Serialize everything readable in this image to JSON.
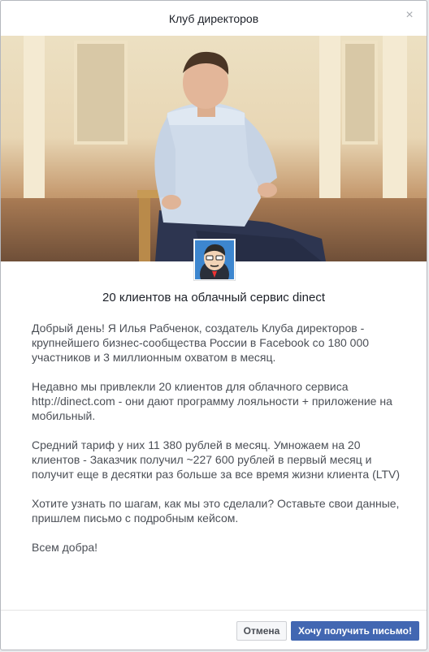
{
  "dialog": {
    "title": "Клуб директоров",
    "close_label": "×"
  },
  "content": {
    "headline": "20 клиентов на облачный сервис dinect",
    "paragraphs": [
      "Добрый день! Я Илья Рабченок, создатель Клуба директоров - крупнейшего бизнес-сообщества России в Facebook со 180 000 участников и 3 миллионным охватом в месяц.",
      "Недавно мы привлекли 20 клиентов для облачного сервиса http://dinect.com - они дают программу лояльности + приложение на мобильный.",
      "Средний тариф у них 11 380 рублей в месяц. Умножаем на 20 клиентов - Заказчик получил ~227 600 рублей в первый месяц и получит еще в десятки раз больше за все время жизни клиента (LTV)",
      "Хотите узнать по шагам, как мы это сделали? Оставьте свои данные, пришлем письмо с подробным кейсом.",
      "Всем добра!"
    ]
  },
  "footer": {
    "cancel_label": "Отмена",
    "submit_label": "Хочу получить письмо!"
  },
  "colors": {
    "primary": "#4267b2",
    "text": "#4b4f56",
    "title": "#1d2129"
  },
  "icons": {
    "close": "close-icon",
    "avatar": "page-avatar"
  }
}
